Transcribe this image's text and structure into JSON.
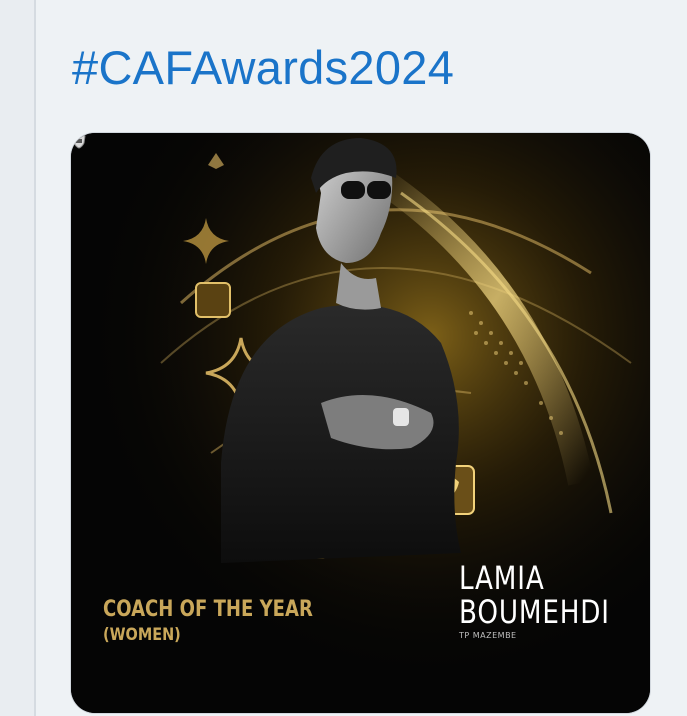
{
  "post": {
    "hashtag": "#CAFAwards2024"
  },
  "media": {
    "award_title": "COACH OF THE YEAR",
    "award_category": "(WOMEN)",
    "name_first": "LAMIA",
    "name_last": "BOUMEHDI",
    "club": "TP MAZEMBE",
    "club_logo_icon": "club-crest-icon",
    "colors": {
      "background": "#050505",
      "gold": "#c9a75a",
      "link": "#1a74c9"
    }
  }
}
